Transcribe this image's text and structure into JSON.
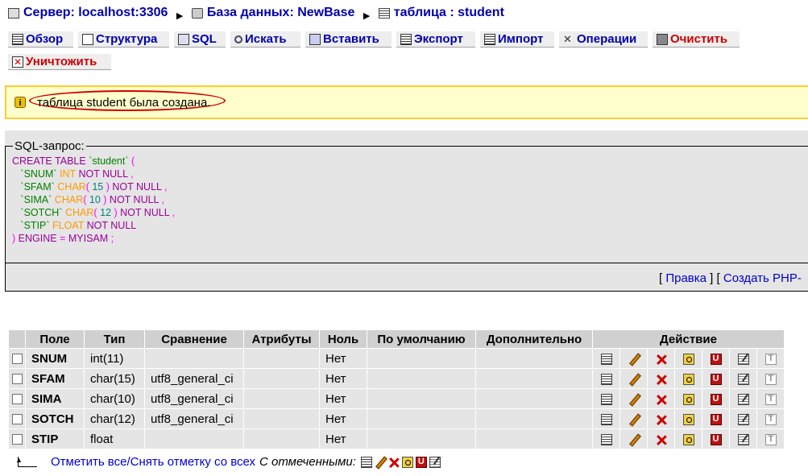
{
  "breadcrumb": {
    "server": "Сервер: localhost:3306",
    "database": "База данных: NewBase",
    "table": "таблица : student"
  },
  "tabs": [
    {
      "label": "Обзор",
      "icon": "browse-icon"
    },
    {
      "label": "Структура",
      "icon": "structure-icon"
    },
    {
      "label": "SQL",
      "icon": "sql-icon"
    },
    {
      "label": "Искать",
      "icon": "search-icon"
    },
    {
      "label": "Вставить",
      "icon": "insert-icon"
    },
    {
      "label": "Экспорт",
      "icon": "export-icon"
    },
    {
      "label": "Импорт",
      "icon": "import-icon"
    },
    {
      "label": "Операции",
      "icon": "operations-icon"
    },
    {
      "label": "Очистить",
      "icon": "empty-icon"
    },
    {
      "label": "Уничтожить",
      "icon": "drop-icon"
    }
  ],
  "notice": {
    "text": "таблица student была создана."
  },
  "sql": {
    "legend": "SQL-запрос:",
    "edit_link": "Правка",
    "php_link": "Создать PHP-"
  },
  "table": {
    "headers": [
      "Поле",
      "Тип",
      "Сравнение",
      "Атрибуты",
      "Ноль",
      "По умолчанию",
      "Дополнительно",
      "Действие"
    ],
    "rows": [
      {
        "field": "SNUM",
        "type": "int(11)",
        "collation": "",
        "attributes": "",
        "null": "Нет",
        "default": "",
        "extra": ""
      },
      {
        "field": "SFAM",
        "type": "char(15)",
        "collation": "utf8_general_ci",
        "attributes": "",
        "null": "Нет",
        "default": "",
        "extra": ""
      },
      {
        "field": "SIMA",
        "type": "char(10)",
        "collation": "utf8_general_ci",
        "attributes": "",
        "null": "Нет",
        "default": "",
        "extra": ""
      },
      {
        "field": "SOTCH",
        "type": "char(12)",
        "collation": "utf8_general_ci",
        "attributes": "",
        "null": "Нет",
        "default": "",
        "extra": ""
      },
      {
        "field": "STIP",
        "type": "float",
        "collation": "",
        "attributes": "",
        "null": "Нет",
        "default": "",
        "extra": ""
      }
    ]
  },
  "footer": {
    "check_all": "Отметить все",
    "separator": " / ",
    "uncheck_all": "Снять отметку со всех",
    "with_selected": "С отмеченными:"
  }
}
